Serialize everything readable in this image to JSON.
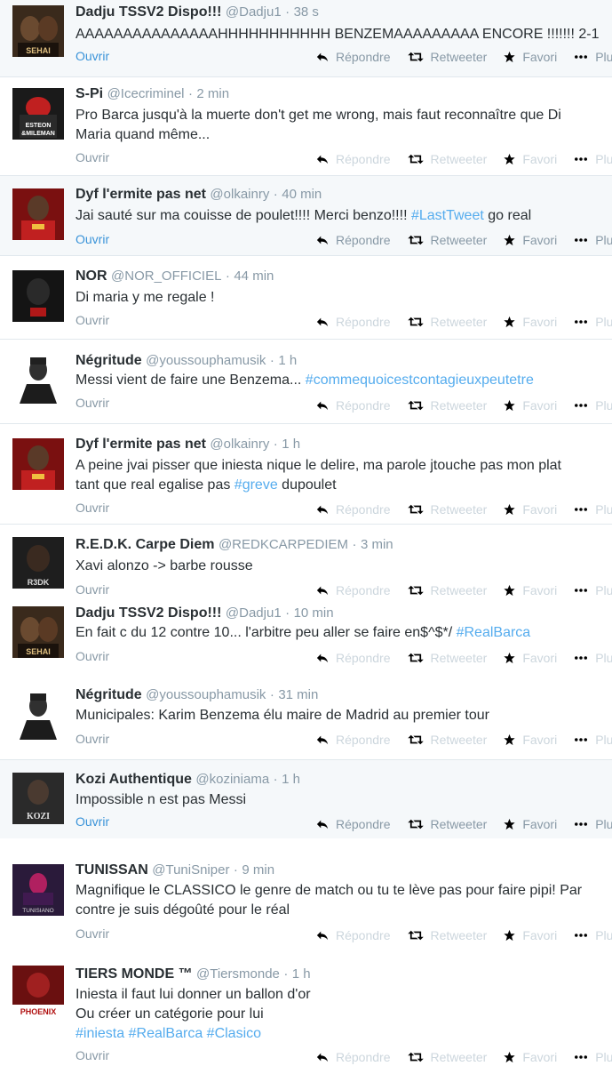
{
  "actions": {
    "reply": "Répondre",
    "retweet": "Retweeter",
    "favorite": "Favori",
    "more": "Plus",
    "open": "Ouvrir"
  },
  "colors": {
    "link": "#55acee",
    "highlight_bg": "#f5f8fa",
    "muted": "#8899a6",
    "inactive": "#ccd6dd"
  },
  "tweets": [
    {
      "name": "Dadju TSSV2 Dispo!!!",
      "handle": "@Dadju1",
      "time": "38 s",
      "lines": [
        [
          "AAAAAAAAAAAAAAAHHHHHHHHHHH BENZEMAAAAAAAAA ENCORE !!!!!!! 2-1"
        ]
      ]
    },
    {
      "name": "S-Pi",
      "handle": "@Icecriminel",
      "time": "2 min",
      "lines": [
        [
          "Pro Barca jusqu'à la muerte don't get me wrong, mais faut reconnaître que Di"
        ],
        [
          "Maria quand même..."
        ]
      ]
    },
    {
      "name": "Dyf l'ermite pas net",
      "handle": "@olkainry",
      "time": "40 min",
      "lines": [
        [
          "Jai sauté sur ma couisse de poulet!!!! Merci benzo!!!! "
        ],
        [
          "#LastTweet"
        ],
        [
          " go real"
        ]
      ]
    },
    {
      "name": "NOR",
      "handle": "@NOR_OFFICIEL",
      "time": "44 min",
      "lines": [
        [
          "Di maria y me regale !"
        ]
      ]
    },
    {
      "name": "Négritude",
      "handle": "@youssouphamusik",
      "time": "1 h",
      "lines": [
        [
          "Messi vient de faire une Benzema... "
        ],
        [
          "#commequoicestcontagieuxpeutetre"
        ]
      ]
    },
    {
      "name": "Dyf l'ermite pas net",
      "handle": "@olkainry",
      "time": "1 h",
      "lines": [
        [
          "A peine jvai pisser que iniesta nique le delire, ma parole jtouche pas mon plat"
        ],
        [
          "tant que real egalise pas "
        ],
        [
          "#greve"
        ],
        [
          " dupoulet"
        ]
      ]
    },
    {
      "name": "R.E.D.K. Carpe Diem",
      "handle": "@REDKCARPEDIEM",
      "time": "3 min",
      "lines": [
        [
          "Xavi alonzo -> barbe rousse"
        ]
      ]
    },
    {
      "name": "Dadju TSSV2 Dispo!!!",
      "handle": "@Dadju1",
      "time": "10 min",
      "lines": [
        [
          "En fait c du 12 contre 10... l'arbitre peu aller se faire en$^$*/ "
        ],
        [
          "#RealBarca"
        ]
      ]
    },
    {
      "name": "Négritude",
      "handle": "@youssouphamusik",
      "time": "31 min",
      "lines": [
        [
          "Municipales: Karim Benzema élu maire de Madrid au premier tour"
        ]
      ]
    },
    {
      "name": "Kozi Authentique",
      "handle": "@koziniama",
      "time": "1 h",
      "lines": [
        [
          "Impossible n est pas Messi"
        ]
      ]
    },
    {
      "name": "TUNISSAN",
      "handle": "@TuniSniper",
      "time": "9 min",
      "lines": [
        [
          "Magnifique le CLASSICO le genre de match ou tu te lève pas pour faire pipi! Par"
        ],
        [
          "contre je suis dégoûté pour le réal"
        ]
      ]
    },
    {
      "name": "TIERS MONDE ™",
      "handle": "@Tiersmonde",
      "time": "1 h",
      "lines": [
        [
          "Iniesta il faut lui donner un ballon d'or"
        ],
        [
          "Ou créer un catégorie pour lui"
        ],
        [
          "#iniesta"
        ],
        [
          " "
        ],
        [
          "#RealBarca"
        ],
        [
          " "
        ],
        [
          "#Clasico"
        ]
      ]
    }
  ],
  "avatars": {
    "dadju_caption": "SEHAI",
    "spi_caption_1": "ESTEON",
    "spi_caption_2": "&MILEMAN",
    "redk_caption": "R3DK",
    "kozi_caption": "KOZI",
    "tunissan_caption": "TUNISIANO",
    "tiers_caption": "PHOENIX"
  }
}
